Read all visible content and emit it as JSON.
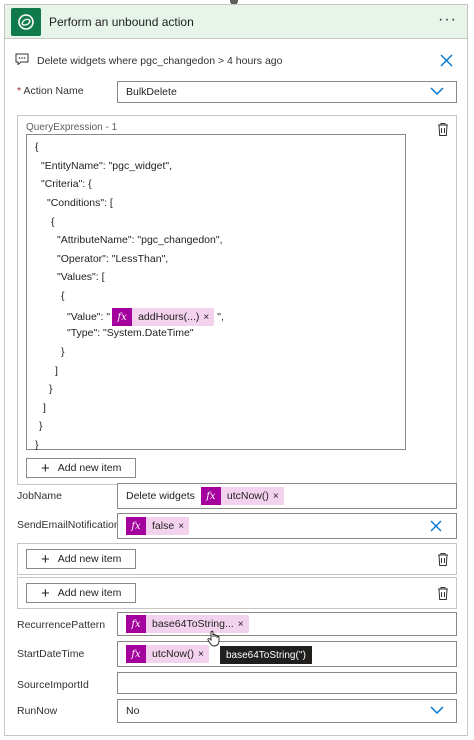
{
  "header": {
    "title": "Perform an unbound action",
    "more_label": "···"
  },
  "comment": {
    "text": "Delete widgets where pgc_changedon > 4 hours ago"
  },
  "action_name": {
    "label": "Action Name",
    "required_marker": "*",
    "value": "BulkDelete"
  },
  "query_expression": {
    "label": "QueryExpression - 1",
    "lines": [
      "{",
      "\"EntityName\": \"pgc_widget\",",
      "\"Criteria\": {",
      "\"Conditions\": [",
      "{",
      "\"AttributeName\": \"pgc_changedon\",",
      "\"Operator\": \"LessThan\",",
      "\"Values\": [",
      "{",
      "\"Value\": \"",
      "\"Type\": \"System.DateTime\"",
      "}",
      "]",
      "}",
      "]",
      "}",
      "}"
    ],
    "value_token": "addHours(...)",
    "value_suffix": "\",",
    "add_item_label": "Add new item"
  },
  "job_name": {
    "label": "JobName",
    "prefix": "Delete widgets",
    "token": "utcNow()"
  },
  "send_email": {
    "label": "SendEmailNotification",
    "token": "false"
  },
  "empty_group_1": {
    "add_item_label": "Add new item"
  },
  "empty_group_2": {
    "add_item_label": "Add new item"
  },
  "recurrence": {
    "label": "RecurrencePattern",
    "token": "base64ToString..."
  },
  "start_date": {
    "label": "StartDateTime",
    "token": "utcNow()",
    "tooltip": "base64ToString('')"
  },
  "source_import": {
    "label": "SourceImportId",
    "value": ""
  },
  "run_now": {
    "label": "RunNow",
    "value": "No"
  },
  "token_remove_glyph": "×",
  "token_fx_glyph": "fx",
  "colors": {
    "accent_blue": "#0078d4",
    "header_bg": "#e6f4ea",
    "logo_green": "#117a4c",
    "token_bg": "#f3d2ee",
    "token_fx": "#a4009e"
  }
}
